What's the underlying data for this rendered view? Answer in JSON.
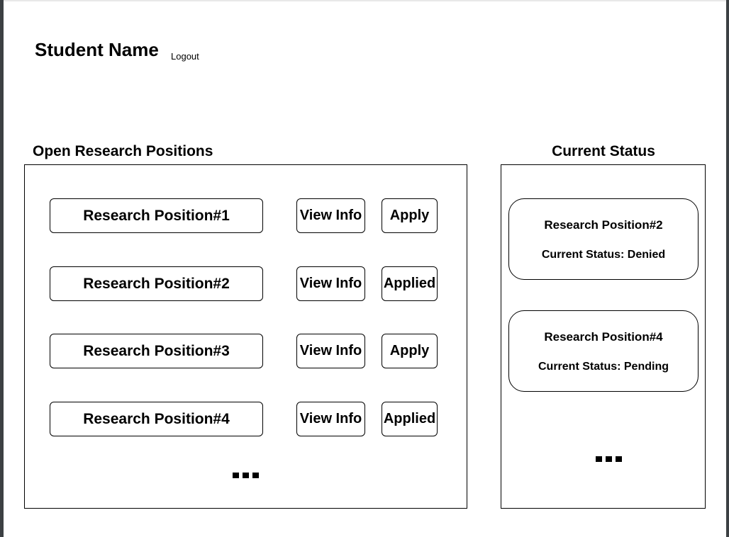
{
  "header": {
    "student_name": "Student Name",
    "logout_label": "Logout"
  },
  "open_positions": {
    "title": "Open Research Positions",
    "rows": [
      {
        "name": "Research Position#1",
        "view_label": "View Info",
        "action_label": "Apply"
      },
      {
        "name": "Research Position#2",
        "view_label": "View Info",
        "action_label": "Applied"
      },
      {
        "name": "Research Position#3",
        "view_label": "View Info",
        "action_label": "Apply"
      },
      {
        "name": "Research Position#4",
        "view_label": "View Info",
        "action_label": "Applied"
      }
    ]
  },
  "current_status": {
    "title": "Current Status",
    "cards": [
      {
        "position": "Research Position#2",
        "status": "Current Status: Denied"
      },
      {
        "position": "Research Position#4",
        "status": "Current Status: Pending"
      }
    ]
  }
}
